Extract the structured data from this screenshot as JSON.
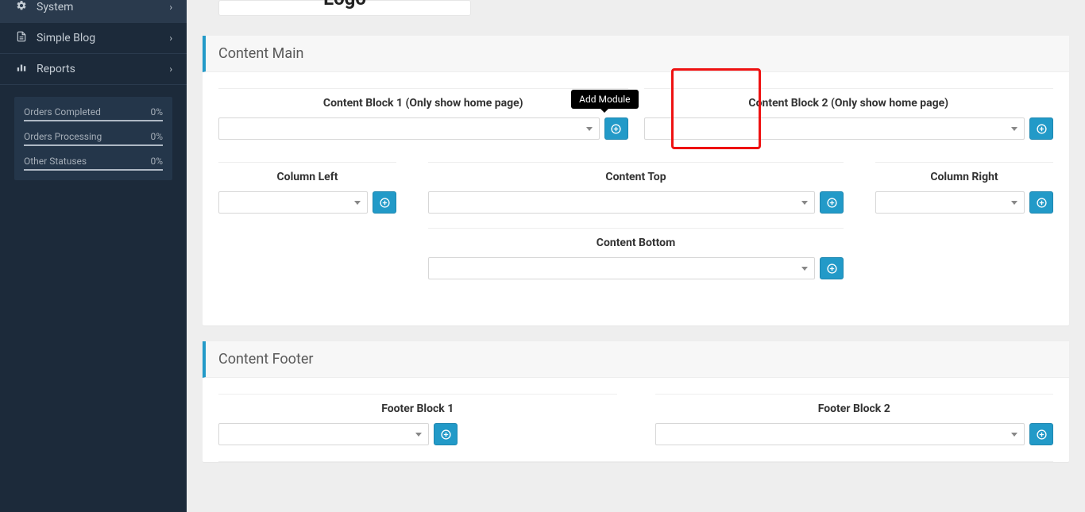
{
  "sidebar": {
    "items": [
      {
        "icon": "gear",
        "label": "System"
      },
      {
        "icon": "file",
        "label": "Simple Blog"
      },
      {
        "icon": "bar-chart",
        "label": "Reports"
      }
    ],
    "stats": [
      {
        "label": "Orders Completed",
        "value": "0%"
      },
      {
        "label": "Orders Processing",
        "value": "0%"
      },
      {
        "label": "Other Statuses",
        "value": "0%"
      }
    ]
  },
  "logo": {
    "text": "Logo"
  },
  "tooltip": {
    "add_module": "Add Module"
  },
  "panels": {
    "content_main": {
      "title": "Content Main",
      "block1": "Content Block 1 (Only show home page)",
      "block2": "Content Block 2 (Only show home page)",
      "col_left": "Column Left",
      "content_top": "Content Top",
      "col_right": "Column Right",
      "content_bottom": "Content Bottom"
    },
    "content_footer": {
      "title": "Content Footer",
      "block1": "Footer Block 1",
      "block2": "Footer Block 2"
    }
  }
}
